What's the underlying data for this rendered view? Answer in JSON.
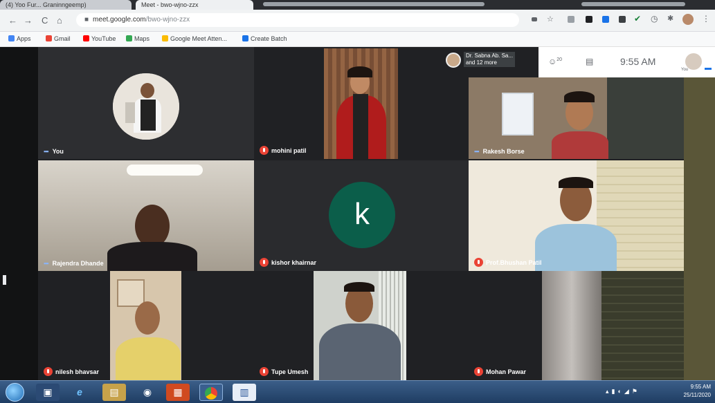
{
  "browser": {
    "tabs": [
      {
        "label": "(4) Yoo Fur... Graninngeemp)"
      },
      {
        "label": "Meet - bwo-wjno-zzx"
      }
    ],
    "url_host": "meet.google.com",
    "url_path": "/bwo-wjno-zzx",
    "nav": {
      "back": "←",
      "forward": "→",
      "reload": "C",
      "home": "⌂"
    },
    "bookmarks": [
      {
        "label": "Apps",
        "color": "#4285f4"
      },
      {
        "label": "Gmail",
        "color": "#ea4335"
      },
      {
        "label": "YouTube",
        "color": "#ff0000"
      },
      {
        "label": "Maps",
        "color": "#34a853"
      },
      {
        "label": "Google Meet Atten...",
        "color": "#fbbc04"
      },
      {
        "label": "Create Batch",
        "color": "#1a73e8"
      }
    ]
  },
  "meet": {
    "participants_chip": {
      "line1": "Dr. Sabna Ab. Sa...",
      "line2": "and 12 more"
    },
    "participants_count": "20",
    "time": "9:55 AM",
    "self_label": "You",
    "tiles": [
      {
        "name": "You",
        "indicator": "speaking"
      },
      {
        "name": "mohini patil",
        "indicator": "muted"
      },
      {
        "name": "Rakesh Borse",
        "indicator": "speaking"
      },
      {
        "name": "Rajendra Dhande",
        "indicator": "speaking"
      },
      {
        "name": "kishor khairnar",
        "indicator": "muted",
        "initial": "k"
      },
      {
        "name": "Prof.Bhushan Patil",
        "indicator": "muted"
      },
      {
        "name": "nilesh bhavsar",
        "indicator": "muted"
      },
      {
        "name": "Tupe Umesh",
        "indicator": "muted"
      },
      {
        "name": "Mohan Pawar",
        "indicator": "muted"
      }
    ]
  },
  "taskbar": {
    "time": "9:55 AM",
    "date": "25/11/2020",
    "apps": [
      "windows-explorer",
      "internet-explorer",
      "file-manager",
      "media-player",
      "powerpoint",
      "chrome",
      "word-processor"
    ]
  }
}
